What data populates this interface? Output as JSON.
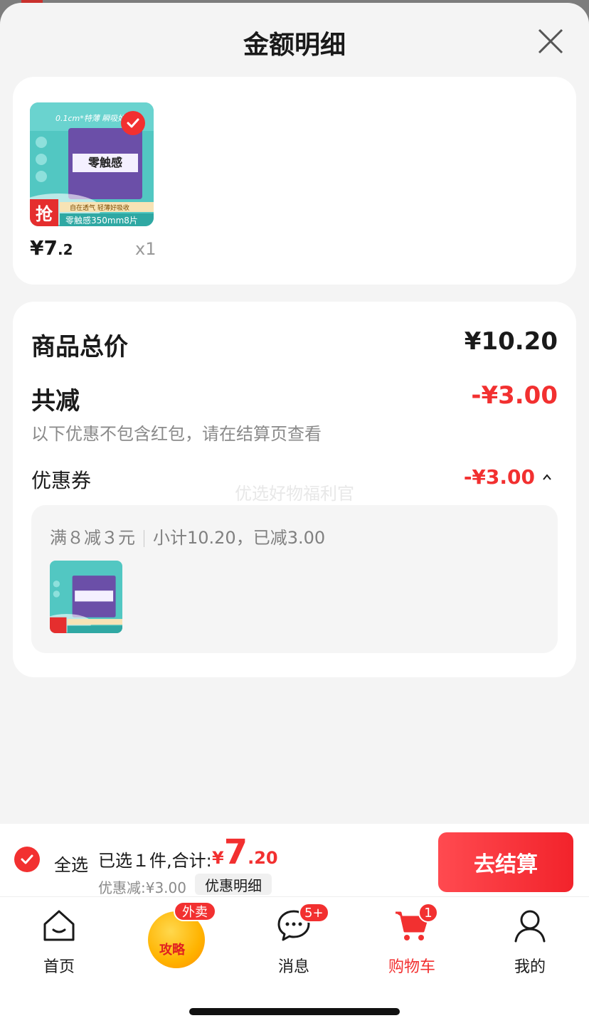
{
  "sheet": {
    "title": "金额明细"
  },
  "product": {
    "price_main": "¥7",
    "price_cents": ".2",
    "qty": "x1",
    "thumb_brand": "0.1cm*特薄 瞬吸好舒爽",
    "thumb_name": "零触感",
    "thumb_tag": "抢",
    "thumb_slogan": "自在透气 轻薄好吸收",
    "thumb_spec": "零触感350mm8片"
  },
  "summary": {
    "total_label": "商品总价",
    "total_value": "¥10.20",
    "reduce_label": "共减",
    "reduce_value": "-¥3.00",
    "note": "以下优惠不包含红包，请在结算页查看",
    "coupon_label": "优惠券",
    "coupon_value": "-¥3.00",
    "watermark": "优选好物福利官",
    "coupon_rule": "满８减３元",
    "coupon_subtotal": "小计10.20，已减3.00"
  },
  "checkout": {
    "select_all": "全选",
    "selected_text": "已选１件,合计:",
    "total_yen": "¥",
    "total_int": "7",
    "total_dec": ".20",
    "discount": "优惠减:¥3.00",
    "detail_chip": "优惠明细",
    "button": "去结算"
  },
  "tabs": {
    "home": "首页",
    "promo": "攻略",
    "promo_badge": "外卖",
    "messages": "消息",
    "messages_badge": "5+",
    "cart": "购物车",
    "cart_badge": "1",
    "mine": "我的"
  },
  "colors": {
    "accent": "#f23030",
    "background": "#f4f4f4"
  }
}
